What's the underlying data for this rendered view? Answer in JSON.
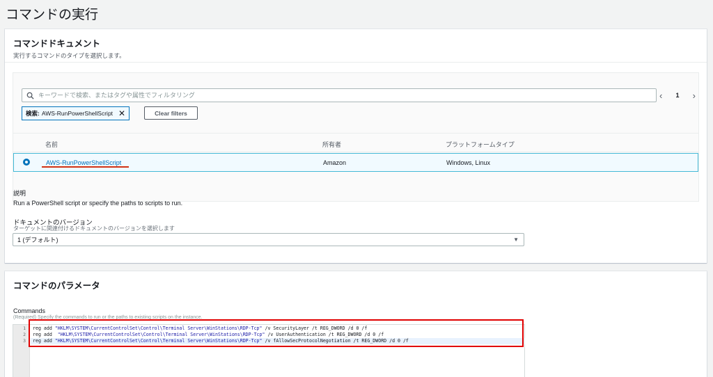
{
  "page_title": "コマンドの実行",
  "document_panel": {
    "title": "コマンドドキュメント",
    "description": "実行するコマンドのタイプを選択します。",
    "search_placeholder": "キーワードで検索、またはタグや属性でフィルタリング",
    "pagination": {
      "prev": "‹",
      "page": "1",
      "next": "›"
    },
    "filter_chip": {
      "key": "検索:",
      "value": "AWS-RunPowerShellScript",
      "remove": "✕"
    },
    "clear_filters": "Clear filters",
    "columns": [
      "名前",
      "所有者",
      "プラットフォームタイプ"
    ],
    "selected_row": {
      "name": "AWS-RunPowerShellScript",
      "owner": "Amazon",
      "platform": "Windows, Linux"
    },
    "description_label": "説明",
    "description_text": "Run a PowerShell script or specify the paths to scripts to run.",
    "version_label": "ドキュメントのバージョン",
    "version_hint": "ターゲットに関連付けるドキュメントのバージョンを選択します",
    "version_value": "1 (デフォルト)",
    "annotation_color": "#d13212"
  },
  "params_panel": {
    "title": "コマンドのパラメータ",
    "commands_label": "Commands",
    "commands_hint": "(Required) Specify the commands to run or the paths to existing scripts on the instance.",
    "lines": [
      {
        "num": "1",
        "cmd": "reg add ",
        "path": "\"HKLM\\SYSTEM\\CurrentControlSet\\Control\\Terminal Server\\WinStations\\RDP-Tcp\"",
        "rest": " /v SecurityLayer /t REG_DWORD /d 0 /f"
      },
      {
        "num": "2",
        "cmd": "reg add  ",
        "path": "\"HKLM\\SYSTEM\\CurrentControlSet\\Control\\Terminal Server\\WinStations\\RDP-Tcp\"",
        "rest": " /v UserAuthentication /t REG_DWORD /d 0 /f"
      },
      {
        "num": "3",
        "cmd": "reg add ",
        "path": "\"HKLM\\SYSTEM\\CurrentControlSet\\Control\\Terminal Server\\WinStations\\RDP-Tcp\"",
        "rest": " /v fAllowSecProtocolNegotiation /t REG_DWORD /d 0 /f"
      }
    ],
    "annotation_color": "#e00000"
  }
}
